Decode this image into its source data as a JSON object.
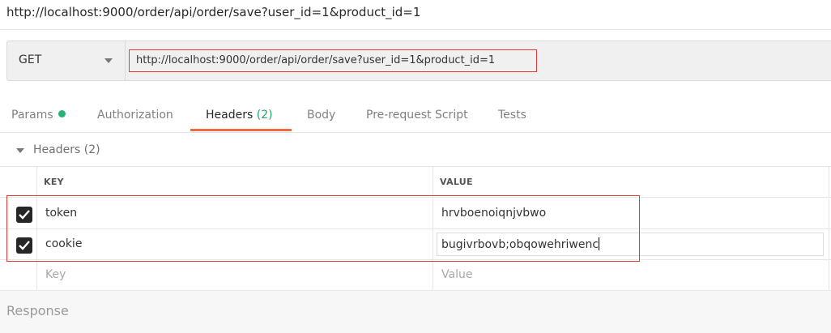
{
  "title": "http://localhost:9000/order/api/order/save?user_id=1&product_id=1",
  "request": {
    "method": "GET",
    "url": "http://localhost:9000/order/api/order/save?user_id=1&product_id=1"
  },
  "tabs": [
    {
      "label": "Params",
      "count": ""
    },
    {
      "label": "Authorization",
      "count": ""
    },
    {
      "label": "Headers",
      "count": "(2)"
    },
    {
      "label": "Body",
      "count": ""
    },
    {
      "label": "Pre-request Script",
      "count": ""
    },
    {
      "label": "Tests",
      "count": ""
    }
  ],
  "active_tab": "Headers",
  "headers_section": {
    "title": "Headers",
    "count": "(2)"
  },
  "table": {
    "columns": {
      "key": "KEY",
      "value": "VALUE"
    },
    "rows": [
      {
        "checked": true,
        "key": "token",
        "value": "hrvboenoiqnjvbwo"
      },
      {
        "checked": true,
        "key": "cookie",
        "value": "bugivrbovb;obqowehriwenc"
      }
    ],
    "placeholder": {
      "key": "Key",
      "value": "Value"
    }
  },
  "response": {
    "label": "Response"
  },
  "colors": {
    "accent": "#f26b3a",
    "params_dot": "#26b276",
    "highlight": "#e53935"
  }
}
